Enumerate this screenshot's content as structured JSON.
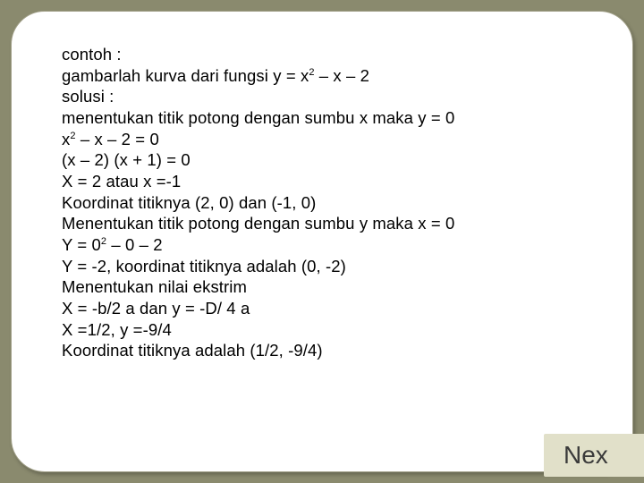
{
  "lines": {
    "l0": "contoh :",
    "l1_a": "gambarlah kurva dari fungsi y = x",
    "l1_b": " – x – 2",
    "l2": "solusi :",
    "l3": "menentukan titik potong dengan sumbu x maka y = 0",
    "l4_a": "x",
    "l4_b": " – x – 2 = 0",
    "l5": "(x – 2) (x + 1) = 0",
    "l6": "X = 2 atau x =-1",
    "l7": "Koordinat titiknya (2, 0) dan (-1, 0)",
    "l8": "Menentukan titik potong dengan sumbu y maka x = 0",
    "l9_a": "Y = 0",
    "l9_b": " – 0 – 2",
    "l10": "Y = -2, koordinat titiknya adalah (0, -2)",
    "l11": "Menentukan nilai ekstrim",
    "l12": "X = -b/2 a dan y = -D/ 4 a",
    "l13": "X =1/2, y =-9/4",
    "l14": "Koordinat titiknya adalah (1/2, -9/4)"
  },
  "exp2": "2",
  "button": {
    "next": "Nex"
  }
}
